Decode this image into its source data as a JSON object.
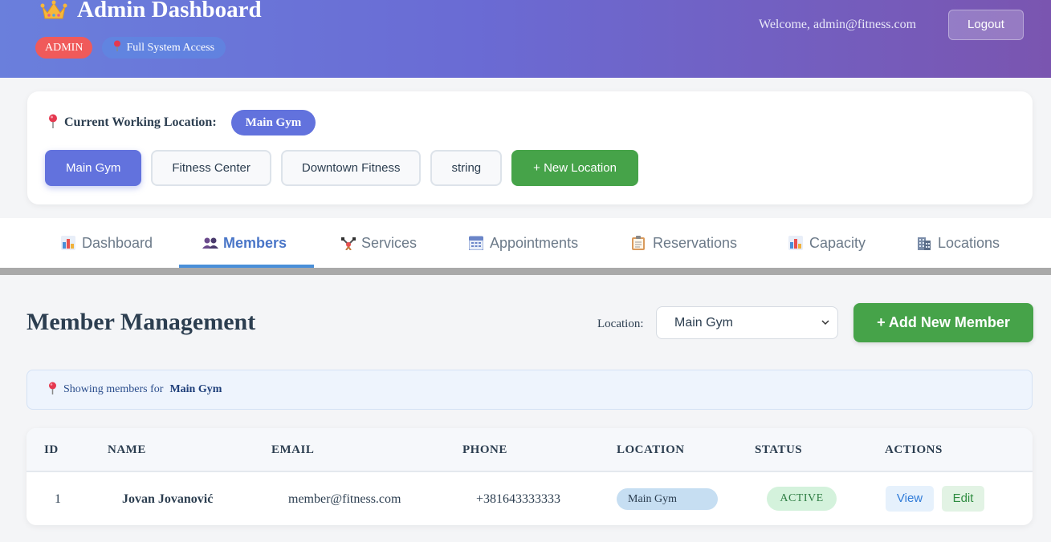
{
  "header": {
    "title": "Admin Dashboard",
    "role_badge": "ADMIN",
    "access_badge": "Full System Access",
    "welcome": "Welcome, admin@fitness.com",
    "logout_label": "Logout",
    "icons": {
      "crown": "crown-icon",
      "pin": "pin-icon"
    }
  },
  "location_card": {
    "label": "Current Working Location:",
    "current": "Main Gym",
    "buttons": [
      "Main Gym",
      "Fitness Center",
      "Downtown Fitness",
      "string"
    ],
    "active_index": 0,
    "new_location_label": "+ New Location"
  },
  "tabs": [
    {
      "label": "Dashboard",
      "icon": "chart-icon"
    },
    {
      "label": "Members",
      "icon": "people-icon"
    },
    {
      "label": "Services",
      "icon": "dumbbell-icon"
    },
    {
      "label": "Appointments",
      "icon": "calendar-icon"
    },
    {
      "label": "Reservations",
      "icon": "clipboard-icon"
    },
    {
      "label": "Capacity",
      "icon": "chart-icon"
    },
    {
      "label": "Locations",
      "icon": "building-icon"
    }
  ],
  "active_tab": "Members",
  "main": {
    "title": "Member Management",
    "location_filter_label": "Location:",
    "location_filter_value": "Main Gym",
    "add_button": "+ Add New Member",
    "info_prefix": "Showing members for",
    "info_location": "Main Gym"
  },
  "table": {
    "headers": [
      "ID",
      "NAME",
      "EMAIL",
      "PHONE",
      "LOCATION",
      "STATUS",
      "ACTIONS"
    ],
    "rows": [
      {
        "id": "1",
        "name": "Jovan Jovanović",
        "email": "member@fitness.com",
        "phone": "+381643333333",
        "location": "Main Gym",
        "status": "ACTIVE",
        "actions": [
          "View",
          "Edit"
        ]
      }
    ]
  },
  "colors": {
    "primary": "#6272dd",
    "success": "#46a349",
    "danger": "#f05a5a",
    "header_gradient_start": "#6a7fdc",
    "header_gradient_end": "#7a55b0"
  }
}
